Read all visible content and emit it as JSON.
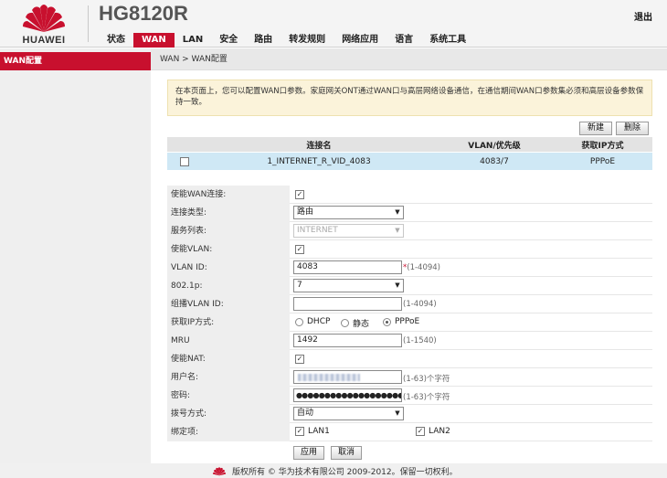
{
  "brand": {
    "logo_text": "HUAWEI",
    "product": "HG8120R",
    "logout": "退出",
    "accent": "#c8102e"
  },
  "nav": {
    "items": [
      {
        "label": "状态"
      },
      {
        "label": "WAN"
      },
      {
        "label": "LAN"
      },
      {
        "label": "安全"
      },
      {
        "label": "路由"
      },
      {
        "label": "转发规则"
      },
      {
        "label": "网络应用"
      },
      {
        "label": "语言"
      },
      {
        "label": "系统工具"
      }
    ]
  },
  "sidebar": {
    "items": [
      {
        "label": "WAN配置"
      }
    ]
  },
  "breadcrumb": "WAN > WAN配置",
  "info_text": "在本页面上，您可以配置WAN口参数。家庭网关ONT通过WAN口与高层网络设备通信，在通信期间WAN口参数集必须和高层设备参数保持一致。",
  "toolbar": {
    "new_label": "新建",
    "delete_label": "删除"
  },
  "connections": {
    "headers": {
      "name": "连接名",
      "vlan": "VLAN/优先级",
      "ip_mode": "获取IP方式"
    },
    "rows": [
      {
        "name": "1_INTERNET_R_VID_4083",
        "vlan": "4083/7",
        "ip_mode": "PPPoE",
        "selected": false
      }
    ]
  },
  "form": {
    "enable_wan": {
      "label": "使能WAN连接:",
      "checked": true
    },
    "conn_type": {
      "label": "连接类型:",
      "value": "路由"
    },
    "service_list": {
      "label": "服务列表:",
      "value": "INTERNET"
    },
    "enable_vlan": {
      "label": "使能VLAN:",
      "checked": true
    },
    "vlan_id": {
      "label": "VLAN ID:",
      "value": "4083",
      "required_mark": "*",
      "hint": "(1-4094)"
    },
    "dot1p": {
      "label": "802.1p:",
      "value": "7"
    },
    "multicast_vlan": {
      "label": "组播VLAN ID:",
      "value": "",
      "hint": "(1-4094)"
    },
    "ip_mode": {
      "label": "获取IP方式:",
      "options": [
        "DHCP",
        "静态",
        "PPPoE"
      ],
      "selected": "PPPoE"
    },
    "mru": {
      "label": "MRU",
      "value": "1492",
      "hint": "(1-1540)"
    },
    "enable_nat": {
      "label": "使能NAT:",
      "checked": true
    },
    "username": {
      "label": "用户名:",
      "hint": "(1-63)个字符"
    },
    "password": {
      "label": "密码:",
      "value": "●●●●●●●●●●●●●●●●●●●●●●●●●●●●●●●●●●●●●●●●",
      "hint": "(1-63)个字符"
    },
    "dial_mode": {
      "label": "拨号方式:",
      "value": "自动"
    },
    "binding": {
      "label": "绑定项:",
      "options": [
        "LAN1",
        "LAN2"
      ],
      "checked": [
        true,
        true
      ]
    }
  },
  "actions": {
    "apply_label": "应用",
    "cancel_label": "取消"
  },
  "footer": {
    "text": "版权所有 © 华为技术有限公司 2009-2012。保留一切权利。"
  }
}
